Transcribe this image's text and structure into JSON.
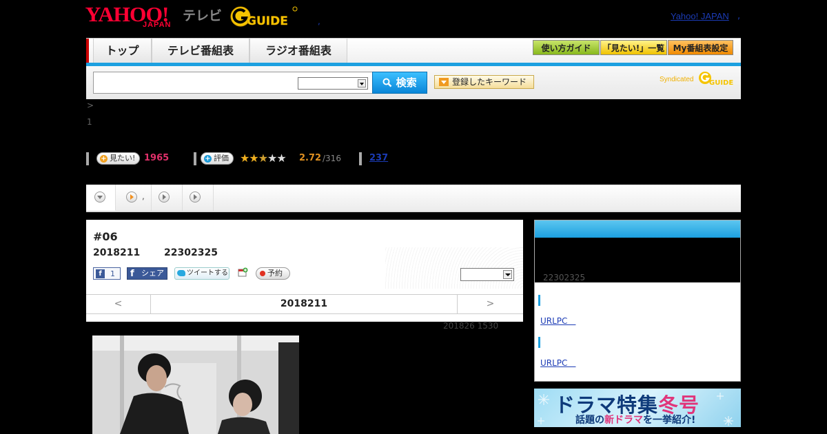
{
  "header": {
    "yahoo_logo": "YAHOO!",
    "yahoo_logo_sub": "JAPAN",
    "tv_label": "テレビ",
    "gguide_logo": "GUIDE",
    "yahoo_link": "Yahoo! JAPAN",
    "separator": ",",
    "small_comma": ","
  },
  "nav": {
    "tabs": [
      {
        "label": "トップ"
      },
      {
        "label": "テレビ番組表"
      },
      {
        "label": "ラジオ番組表"
      }
    ],
    "buttons": [
      {
        "label": "使い方ガイド",
        "color": "#88b81c"
      },
      {
        "label": "「見たい!」一覧",
        "color": "#f0c200"
      },
      {
        "label": "My番組表設定",
        "color": "#f08a00"
      }
    ]
  },
  "search": {
    "input_value": "",
    "select_value": "",
    "button_label": "検索",
    "keyword_button_label": "登録したキーワード",
    "syndicated_label": "Syndicated",
    "syndicated_logo": "GUIDE"
  },
  "breadcrumb": {
    "text": ">",
    "sub": "1"
  },
  "stats": {
    "want_label": "見たい!",
    "want_count": "1965",
    "rating_label": "評価",
    "stars_filled": 2,
    "stars_half": 1,
    "stars_total": 5,
    "rating_value": "2.72",
    "rating_total": "/316",
    "count_link": "237"
  },
  "tabstrip": {
    "tab2_label": ","
  },
  "program": {
    "episode": "#06",
    "date": "2018211",
    "time": "22302325",
    "fb_like_count": "1",
    "fb_share_label": "シェア",
    "tweet_label": "ツイートする",
    "reserve_label": "予約",
    "select_value": "",
    "pager": {
      "prev": "<",
      "current": "2018211",
      "next": ">"
    },
    "updated": "201826  1530"
  },
  "right_panel": {
    "time": "22302325",
    "link1": "URLPC　",
    "link2": "URLPC　"
  },
  "banner": {
    "title_main": "ドラマ特集",
    "title_accent": "冬号",
    "sub_pre": "話題の",
    "sub_hl": "新ドラマ",
    "sub_post": "を一挙紹介!"
  }
}
